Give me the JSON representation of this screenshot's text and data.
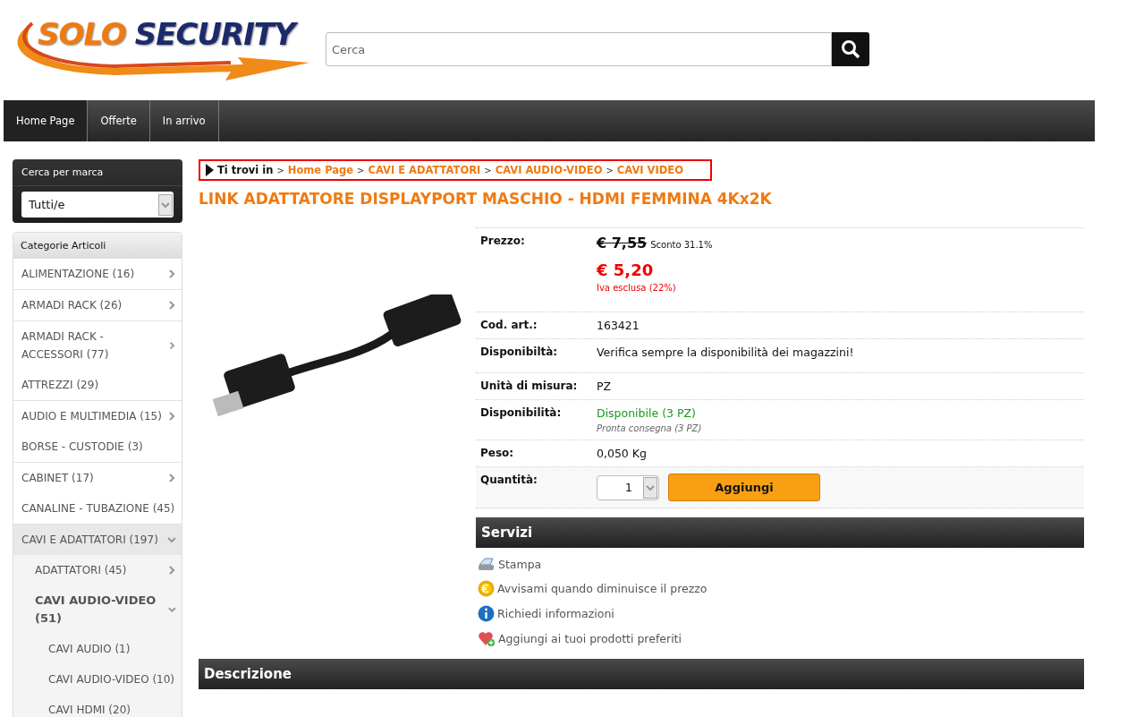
{
  "logo": {
    "word_1": "SOLO",
    "word_2": "SECURITY"
  },
  "search": {
    "placeholder": "Cerca"
  },
  "nav": [
    {
      "label": "Home Page",
      "selected": true
    },
    {
      "label": "Offerte",
      "selected": false
    },
    {
      "label": "In arrivo",
      "selected": false
    }
  ],
  "brand_filter": {
    "title": "Cerca per marca",
    "value": "Tutti/e"
  },
  "categories": {
    "title": "Categorie Articoli",
    "items": [
      {
        "label": "ALIMENTAZIONE (16)",
        "expandable": true,
        "expanded": false,
        "selected": false
      },
      {
        "label": "ARMADI RACK (26)",
        "expandable": true,
        "expanded": false,
        "selected": false
      },
      {
        "label": "ARMADI RACK - ACCESSORI (77)",
        "expandable": true,
        "expanded": false,
        "selected": false
      },
      {
        "label": "ATTREZZI (29)",
        "expandable": false,
        "expanded": false,
        "selected": false
      },
      {
        "label": "AUDIO E MULTIMEDIA (15)",
        "expandable": true,
        "expanded": false,
        "selected": false
      },
      {
        "label": "BORSE - CUSTODIE (3)",
        "expandable": false,
        "expanded": false,
        "selected": false
      },
      {
        "label": "CABINET (17)",
        "expandable": true,
        "expanded": false,
        "selected": false
      },
      {
        "label": "CANALINE - TUBAZIONE (45)",
        "expandable": false,
        "expanded": false,
        "selected": false
      },
      {
        "label": "CAVI E ADATTATORI (197)",
        "expandable": true,
        "expanded": true,
        "selected": false,
        "children": [
          {
            "label": "ADATTATORI (45)",
            "expandable": true,
            "expanded": false,
            "selected": false
          },
          {
            "label": "CAVI AUDIO-VIDEO (51)",
            "expandable": true,
            "expanded": true,
            "selected": true,
            "children": [
              {
                "label": "CAVI AUDIO (1)",
                "expandable": false,
                "expanded": false,
                "selected": false
              },
              {
                "label": "CAVI AUDIO-VIDEO (10)",
                "expandable": false,
                "expanded": false,
                "selected": false
              },
              {
                "label": "CAVI HDMI (20)",
                "expandable": false,
                "expanded": false,
                "selected": false
              }
            ]
          }
        ]
      }
    ]
  },
  "breadcrumb": {
    "label": "Ti trovi in",
    "separator": ">",
    "links": [
      "Home Page",
      "CAVI E ADATTATORI",
      "CAVI AUDIO-VIDEO",
      "CAVI VIDEO"
    ]
  },
  "product": {
    "title": "LINK ADATTATORE DISPLAYPORT MASCHIO - HDMI FEMMINA 4Kx2K",
    "details": [
      {
        "kind": "price",
        "label": "Prezzo:",
        "old_price": "€ 7,55",
        "discount": "Sconto 31.1%",
        "price": "€ 5,20",
        "note": "Iva esclusa (22%)"
      },
      {
        "kind": "text",
        "label": "Cod. art.:",
        "value": "163421"
      },
      {
        "kind": "text",
        "label": "Disponibiltà:",
        "value": "Verifica sempre la disponibilità dei magazzini!"
      },
      {
        "kind": "text",
        "label": "Unità di misura:",
        "value": "PZ"
      },
      {
        "kind": "availability",
        "label": "Disponibilità:",
        "value": "Disponibile (3 PZ)",
        "note": "Pronta consegna (3 PZ)"
      },
      {
        "kind": "text",
        "label": "Peso:",
        "value": "0,050 Kg"
      },
      {
        "kind": "quantity",
        "label": "Quantità:",
        "value": "1",
        "button": "Aggiungi"
      }
    ]
  },
  "services": {
    "title": "Servizi",
    "items": [
      {
        "kind": "print",
        "label": "Stampa"
      },
      {
        "kind": "euro",
        "label": "Avvisami quando diminuisce il prezzo"
      },
      {
        "kind": "info",
        "label": "Richiedi informazioni"
      },
      {
        "kind": "heart",
        "label": "Aggiungi ai tuoi prodotti preferiti"
      }
    ]
  },
  "description": {
    "title": "Descrizione"
  }
}
